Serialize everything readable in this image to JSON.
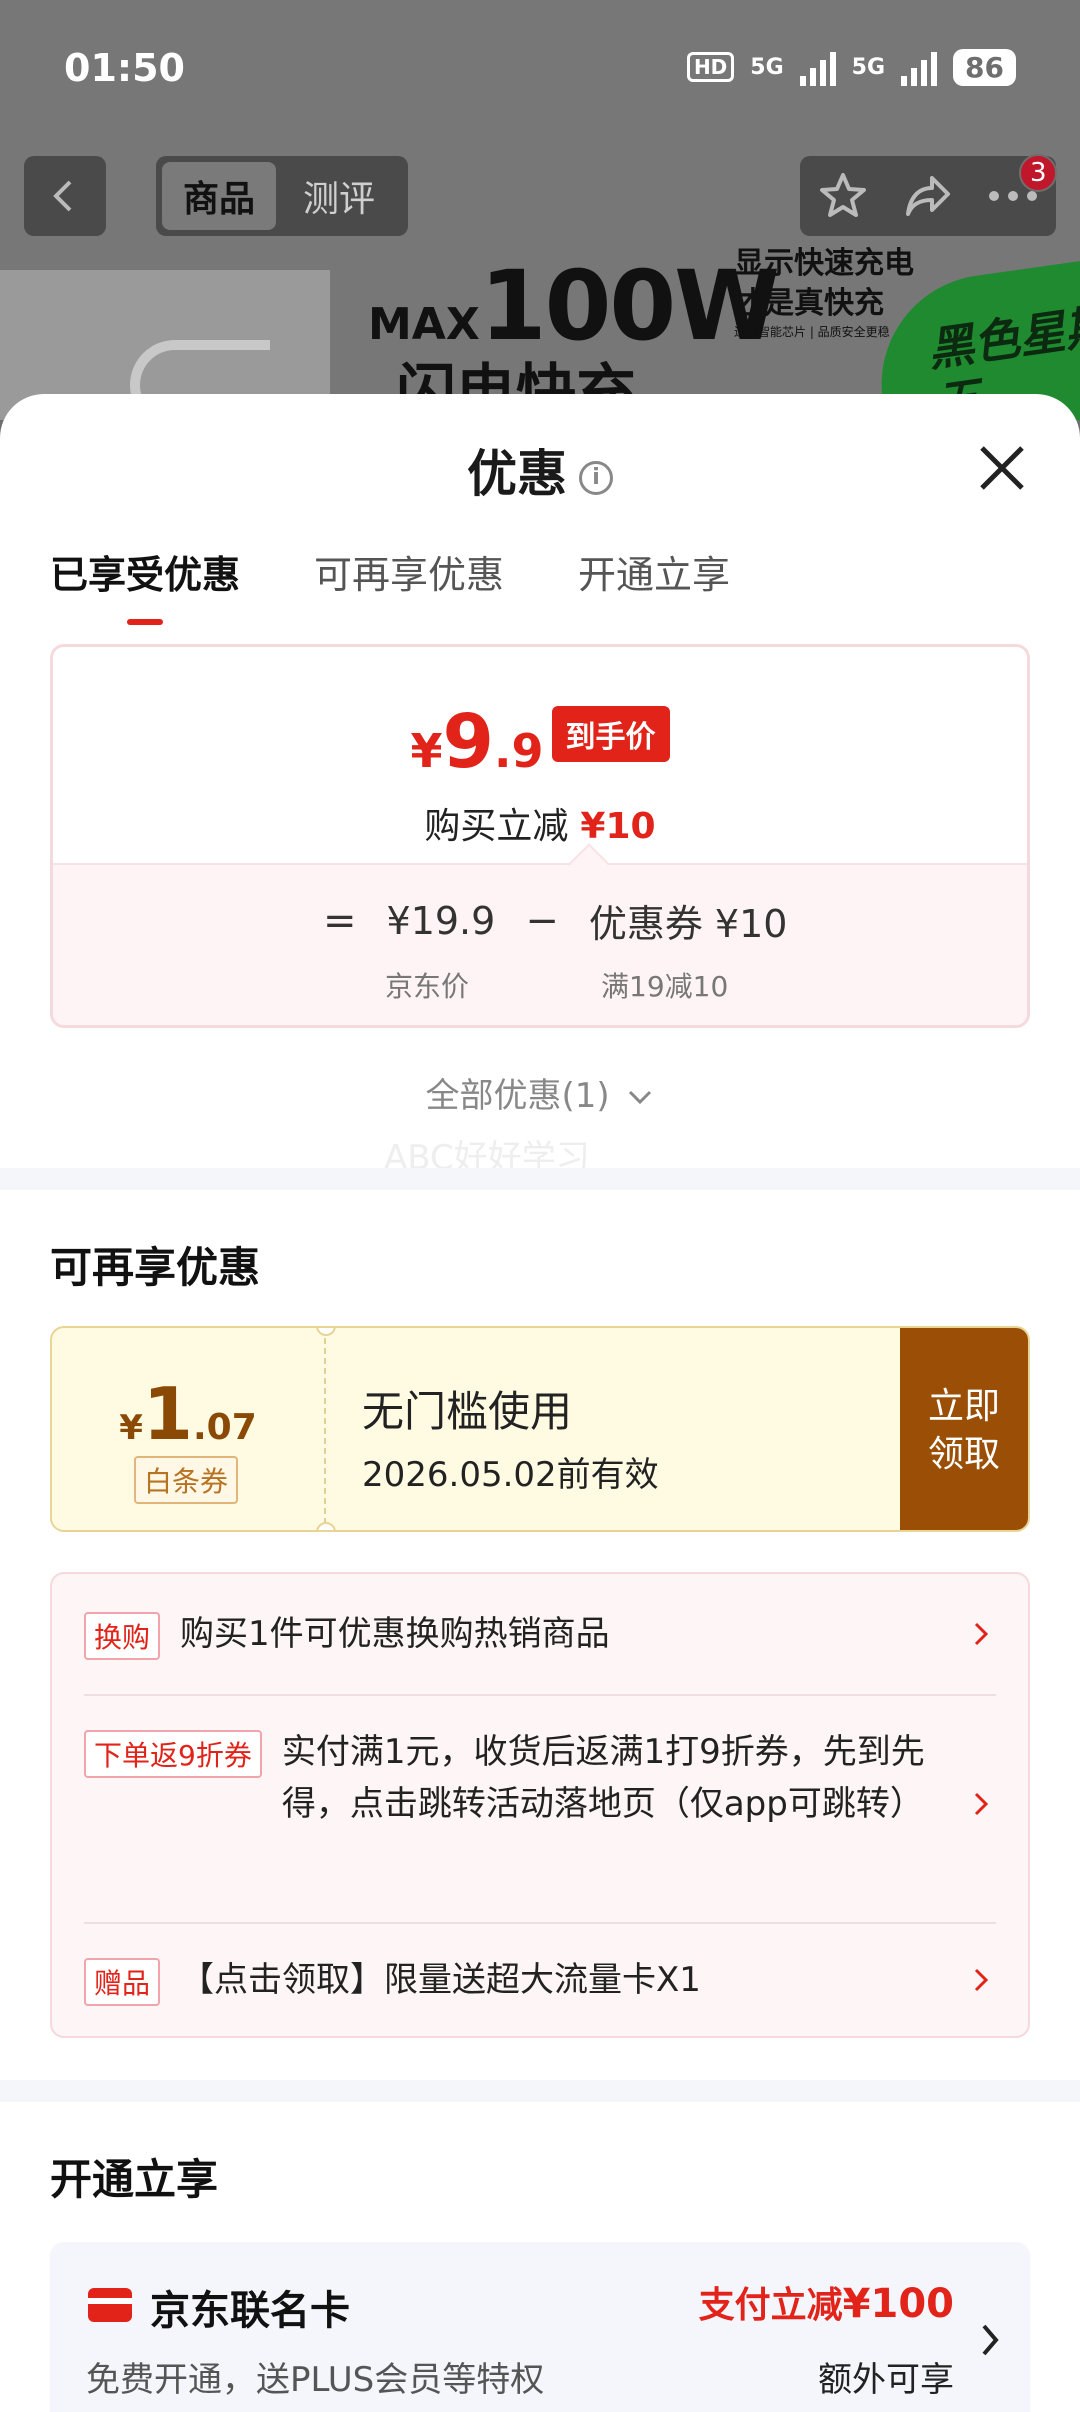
{
  "status": {
    "time": "01:50",
    "hd": "HD",
    "net1": "5G",
    "net2": "5G",
    "battery": "86"
  },
  "nav": {
    "tabs": [
      "商品",
      "测评"
    ],
    "active_tab": 0,
    "cart_badge": "3"
  },
  "banner": {
    "max": "MAX",
    "power": "100W",
    "subtitle": "闪电快充",
    "right_line1": "显示快速充电",
    "right_line2": "才是真快充",
    "right_small": "进口智能芯片 | 品质安全更稳",
    "promo_tag": "黑色星期五"
  },
  "sheet": {
    "title": "优惠",
    "tabs": [
      "已享受优惠",
      "可再享优惠",
      "开通立享"
    ],
    "price_card": {
      "currency": "¥",
      "price_int": "9",
      "price_dec": ".9",
      "tag": "到手价",
      "reduce_label": "购买立减",
      "reduce_value": "¥10",
      "eq": "=",
      "jd_price": "¥19.9",
      "minus": "−",
      "coupon_label": "优惠券 ¥10",
      "jd_price_label": "京东价",
      "coupon_rule": "满19减10"
    },
    "all_deals": "全部优惠(1)",
    "watermark": "ABC好好学习"
  },
  "more_deals": {
    "title": "可再享优惠",
    "coupon": {
      "currency": "¥",
      "amount_int": "1",
      "amount_dec": ".07",
      "type": "白条券",
      "desc": "无门槛使用",
      "validity": "2026.05.02前有效",
      "button": "立即领取"
    },
    "promos": [
      {
        "tag": "换购",
        "text": "购买1件可优惠换购热销商品"
      },
      {
        "tag": "下单返9折券",
        "text": "实付满1元，收货后返满1打9折券，先到先得，点击跳转活动落地页（仅app可跳转）"
      },
      {
        "tag": "赠品",
        "text": "【点击领取】限量送超大流量卡X1"
      }
    ]
  },
  "open_enjoy": {
    "title": "开通立享",
    "card": {
      "name": "京东联名卡",
      "desc": "免费开通，送PLUS会员等特权",
      "save_prefix": "支付立减",
      "save_value": "¥100",
      "extra": "额外可享"
    }
  }
}
